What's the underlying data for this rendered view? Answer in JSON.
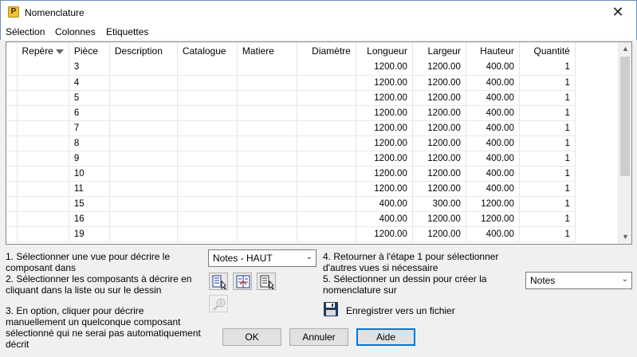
{
  "window": {
    "title": "Nomenclature",
    "close_glyph": "✕",
    "app_icon_letter": "P"
  },
  "menu": {
    "items": [
      "Sélection",
      "Colonnes",
      "Etiquettes"
    ]
  },
  "table": {
    "columns": [
      "Repère",
      "Pièce",
      "Description",
      "Catalogue",
      "Matiere",
      "Diamètre",
      "Longueur",
      "Largeur",
      "Hauteur",
      "Quantité"
    ],
    "rows": [
      [
        "",
        "3",
        "",
        "",
        "",
        "",
        "1200.00",
        "1200.00",
        "400.00",
        "1"
      ],
      [
        "",
        "4",
        "",
        "",
        "",
        "",
        "1200.00",
        "1200.00",
        "400.00",
        "1"
      ],
      [
        "",
        "5",
        "",
        "",
        "",
        "",
        "1200.00",
        "1200.00",
        "400.00",
        "1"
      ],
      [
        "",
        "6",
        "",
        "",
        "",
        "",
        "1200.00",
        "1200.00",
        "400.00",
        "1"
      ],
      [
        "",
        "7",
        "",
        "",
        "",
        "",
        "1200.00",
        "1200.00",
        "400.00",
        "1"
      ],
      [
        "",
        "8",
        "",
        "",
        "",
        "",
        "1200.00",
        "1200.00",
        "400.00",
        "1"
      ],
      [
        "",
        "9",
        "",
        "",
        "",
        "",
        "1200.00",
        "1200.00",
        "400.00",
        "1"
      ],
      [
        "",
        "10",
        "",
        "",
        "",
        "",
        "1200.00",
        "1200.00",
        "400.00",
        "1"
      ],
      [
        "",
        "11",
        "",
        "",
        "",
        "",
        "1200.00",
        "1200.00",
        "400.00",
        "1"
      ],
      [
        "",
        "15",
        "",
        "",
        "",
        "",
        "400.00",
        "300.00",
        "1200.00",
        "1"
      ],
      [
        "",
        "16",
        "",
        "",
        "",
        "",
        "400.00",
        "1200.00",
        "1200.00",
        "1"
      ],
      [
        "",
        "19",
        "",
        "",
        "",
        "",
        "1200.00",
        "1200.00",
        "400.00",
        "1"
      ]
    ]
  },
  "instructions": {
    "step1": "1. Sélectionner une vue pour décrire le composant dans",
    "step2": "2. Sélectionner les composants à décrire en cliquant dans la liste ou sur le dessin",
    "step3": "3. En option, cliquer pour décrire manuellement un quelconque composant sélectionné qui ne serai pas automatiquement décrit",
    "step4": "4. Retourner à l'étape 1 pour sélectionner d'autres vues si nécessaire",
    "step5": "5. Sélectionner un dessin pour créer la nomenclature sur"
  },
  "view_select": {
    "value": "Notes - HAUT"
  },
  "drawing_select": {
    "value": "Notes"
  },
  "save_label": "Enregistrer vers un fichier",
  "buttons": {
    "ok": "OK",
    "cancel": "Annuler",
    "help": "Aide"
  },
  "icons": {
    "sort": "sort-down-icon",
    "select_list": "select-list-icon",
    "select_all": "select-all-icon",
    "select_drawing": "select-drawing-icon",
    "describe_manual": "describe-manual-icon",
    "save": "floppy-disk-icon",
    "chevron": "chevron-down-icon"
  }
}
